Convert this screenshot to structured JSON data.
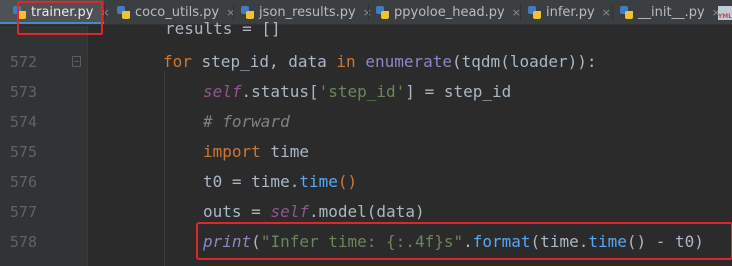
{
  "tabs": [
    {
      "label": "trainer.py",
      "icon": "python-file-icon",
      "active": true
    },
    {
      "label": "coco_utils.py",
      "icon": "python-file-icon"
    },
    {
      "label": "json_results.py",
      "icon": "python-file-icon"
    },
    {
      "label": "ppyoloe_head.py",
      "icon": "python-file-icon"
    },
    {
      "label": "infer.py",
      "icon": "python-file-icon"
    },
    {
      "label": "__init__.py",
      "icon": "python-file-icon"
    }
  ],
  "tab_close_glyph": "×",
  "yml_icon_text": "YML",
  "code": {
    "partial_line": {
      "var": "results",
      "op": " = ",
      "val": "[]"
    },
    "lines": [
      {
        "num": "572",
        "t1": "for",
        "t2": " step_id, data ",
        "t3": "in",
        "t4": " ",
        "t5": "enumerate",
        "t6": "(",
        "t7": "tqdm",
        "t8": "(loader)):"
      },
      {
        "num": "573",
        "t1": "self",
        "t2": ".status[",
        "t3": "'step_id'",
        "t4": "] = step_id"
      },
      {
        "num": "574",
        "t1": "# forward"
      },
      {
        "num": "575",
        "t1": "import",
        "t2": " time"
      },
      {
        "num": "576",
        "t1": "t0 = time.",
        "t2": "time",
        "t3": "()"
      },
      {
        "num": "577",
        "t1": "outs = ",
        "t2": "self",
        "t3": ".",
        "t4": "model",
        "t5": "(data)"
      },
      {
        "num": "578",
        "t1": "print",
        "t2": "(",
        "t3": "\"Infer time: {:.4f}s\"",
        "t4": ".",
        "t5": "format",
        "t6": "(time.",
        "t7": "time",
        "t8": "() - t0)"
      }
    ]
  },
  "colors": {
    "highlight": "#e0262b",
    "keyword": "#cc7832",
    "self": "#94558d",
    "function": "#56a8f5",
    "string": "#6a8759",
    "comment": "#808080"
  }
}
